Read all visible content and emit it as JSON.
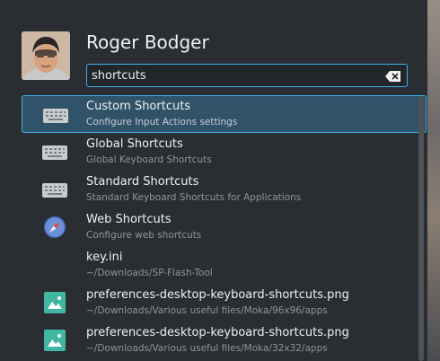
{
  "user": {
    "name": "Roger Bodger"
  },
  "search": {
    "value": "shortcuts"
  },
  "results": [
    {
      "title": "Custom Shortcuts",
      "subtitle": "Configure Input Actions settings",
      "icon": "keyboard-icon"
    },
    {
      "title": "Global Shortcuts",
      "subtitle": "Global Keyboard Shortcuts",
      "icon": "keyboard-icon"
    },
    {
      "title": "Standard Shortcuts",
      "subtitle": "Standard Keyboard Shortcuts for Applications",
      "icon": "keyboard-icon"
    },
    {
      "title": "Web Shortcuts",
      "subtitle": "Configure web shortcuts",
      "icon": "compass-icon"
    },
    {
      "title": "key.ini",
      "subtitle": "~/Downloads/SP-Flash-Tool",
      "icon": ""
    },
    {
      "title": "preferences-desktop-keyboard-shortcuts.png",
      "subtitle": "~/Downloads/Various useful files/Moka/96x96/apps",
      "icon": "image-file-icon"
    },
    {
      "title": "preferences-desktop-keyboard-shortcuts.png",
      "subtitle": "~/Downloads/Various useful files/Moka/32x32/apps",
      "icon": "image-file-icon"
    }
  ],
  "colors": {
    "accent": "#3daee9",
    "selected_bg": "#31536a",
    "panel_bg": "#2a2e32"
  }
}
